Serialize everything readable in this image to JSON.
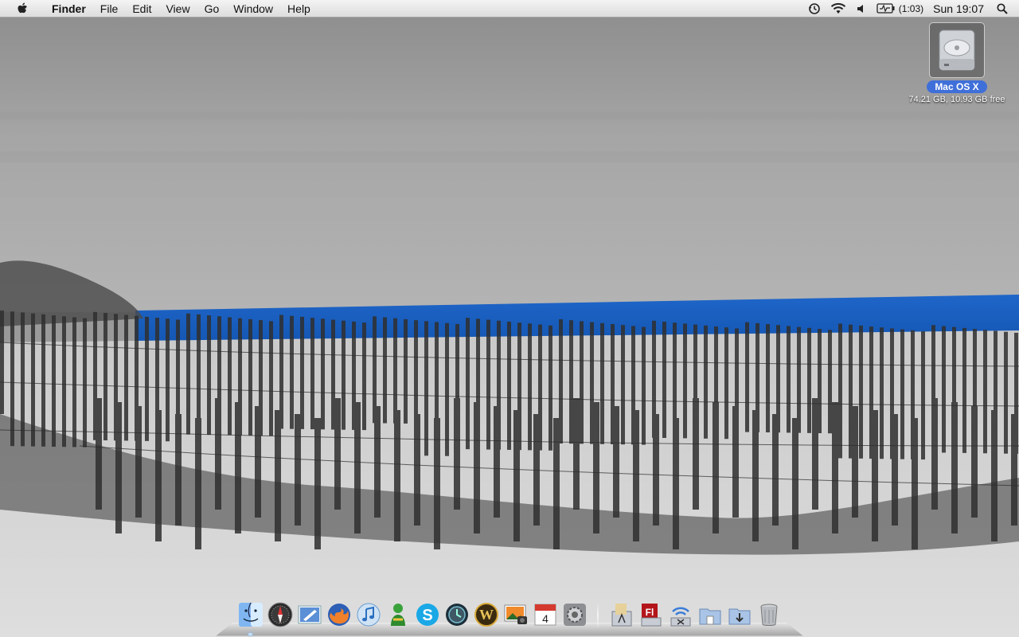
{
  "menubar": {
    "app_name": "Finder",
    "menus": [
      "File",
      "Edit",
      "View",
      "Go",
      "Window",
      "Help"
    ],
    "battery_text": "(1:03)",
    "clock": "Sun 19:07",
    "status_icons": [
      "time-machine-icon",
      "wifi-icon",
      "volume-icon",
      "battery-icon",
      "spotlight-icon"
    ]
  },
  "desktop": {
    "drive_name": "Mac OS X",
    "drive_info": "74.21 GB, 10.93 GB free"
  },
  "dock": {
    "apps": [
      "finder",
      "safari",
      "mail",
      "firefox",
      "itunes",
      "adium",
      "skype",
      "time-machine",
      "world-of-warcraft",
      "iphoto",
      "ical",
      "system-preferences"
    ],
    "stacks": [
      "applications",
      "flash",
      "utilities",
      "documents",
      "downloads",
      "trash"
    ]
  },
  "colors": {
    "sea": "#1e6fd6",
    "menubar": "#e8e8e8",
    "selection": "#3f6fd9"
  }
}
